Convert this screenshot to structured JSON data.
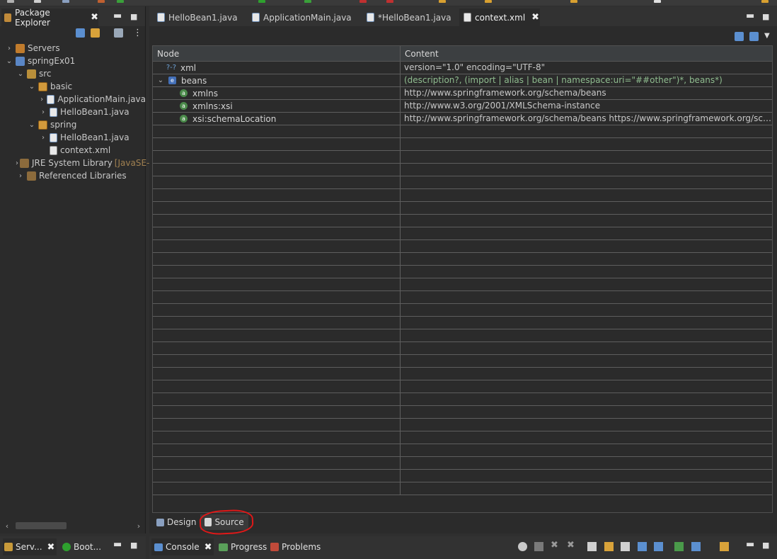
{
  "colors": {
    "accent_red": "#e01818"
  },
  "package_explorer": {
    "tab_label": "Package Explorer",
    "close_glyph": "✖",
    "minimize_glyph": "▬",
    "maximize_glyph": "■",
    "menu_glyph": "⋮",
    "tree": [
      {
        "label": "Servers",
        "icon": "server-folder-icon",
        "twisty": "›"
      },
      {
        "label": "springEx01",
        "icon": "project-icon",
        "twisty": "⌄"
      },
      {
        "label": "src",
        "icon": "source-folder-icon",
        "twisty": "⌄"
      },
      {
        "label": "basic",
        "icon": "package-icon",
        "twisty": "⌄"
      },
      {
        "label": "ApplicationMain.java",
        "icon": "java-file-icon",
        "twisty": "›"
      },
      {
        "label": "HelloBean1.java",
        "icon": "java-file-icon",
        "twisty": "›"
      },
      {
        "label": "spring",
        "icon": "package-icon",
        "twisty": "⌄"
      },
      {
        "label": "HelloBean1.java",
        "icon": "java-file-icon",
        "twisty": "›"
      },
      {
        "label": "context.xml",
        "icon": "xml-file-icon",
        "twisty": ""
      },
      {
        "label": "JRE System Library",
        "suffix": "[JavaSE-",
        "icon": "library-icon",
        "twisty": "›"
      },
      {
        "label": "Referenced Libraries",
        "icon": "library-icon",
        "twisty": "›"
      }
    ]
  },
  "editor": {
    "tabs": [
      {
        "label": "HelloBean1.java",
        "icon": "java-file-icon",
        "active": false
      },
      {
        "label": "ApplicationMain.java",
        "icon": "java-file-icon",
        "active": false
      },
      {
        "label": "*HelloBean1.java",
        "icon": "java-file-icon",
        "active": false
      },
      {
        "label": "context.xml",
        "icon": "xml-file-icon",
        "active": true
      }
    ],
    "columns": {
      "node": "Node",
      "content": "Content"
    },
    "rows": [
      {
        "node": "xml",
        "icon": "processing-instruction-icon",
        "icon_text": "?-?",
        "twisty": "",
        "content": "version=\"1.0\" encoding=\"UTF-8\"",
        "green": false
      },
      {
        "node": "beans",
        "icon": "element-icon",
        "icon_text": "e",
        "twisty": "⌄",
        "content": "(description?, (import | alias | bean | namespace:uri=\"##other\")*, beans*)",
        "green": true
      },
      {
        "node": "xmlns",
        "icon": "attribute-icon",
        "icon_text": "a",
        "twisty": "",
        "content": "http://www.springframework.org/schema/beans",
        "green": false
      },
      {
        "node": "xmlns:xsi",
        "icon": "attribute-icon",
        "icon_text": "a",
        "twisty": "",
        "content": "http://www.w3.org/2001/XMLSchema-instance",
        "green": false
      },
      {
        "node": "xsi:schemaLocation",
        "icon": "attribute-icon",
        "icon_text": "a",
        "twisty": "",
        "content": "http://www.springframework.org/schema/beans https://www.springframework.org/schema/be...",
        "green": false
      }
    ],
    "bottom_tabs": {
      "design": "Design",
      "source": "Source"
    }
  },
  "bottom_left": {
    "servers_label": "Serv...",
    "boot_label": "Boot..."
  },
  "bottom_right": {
    "console_label": "Console",
    "progress_label": "Progress",
    "problems_label": "Problems"
  }
}
